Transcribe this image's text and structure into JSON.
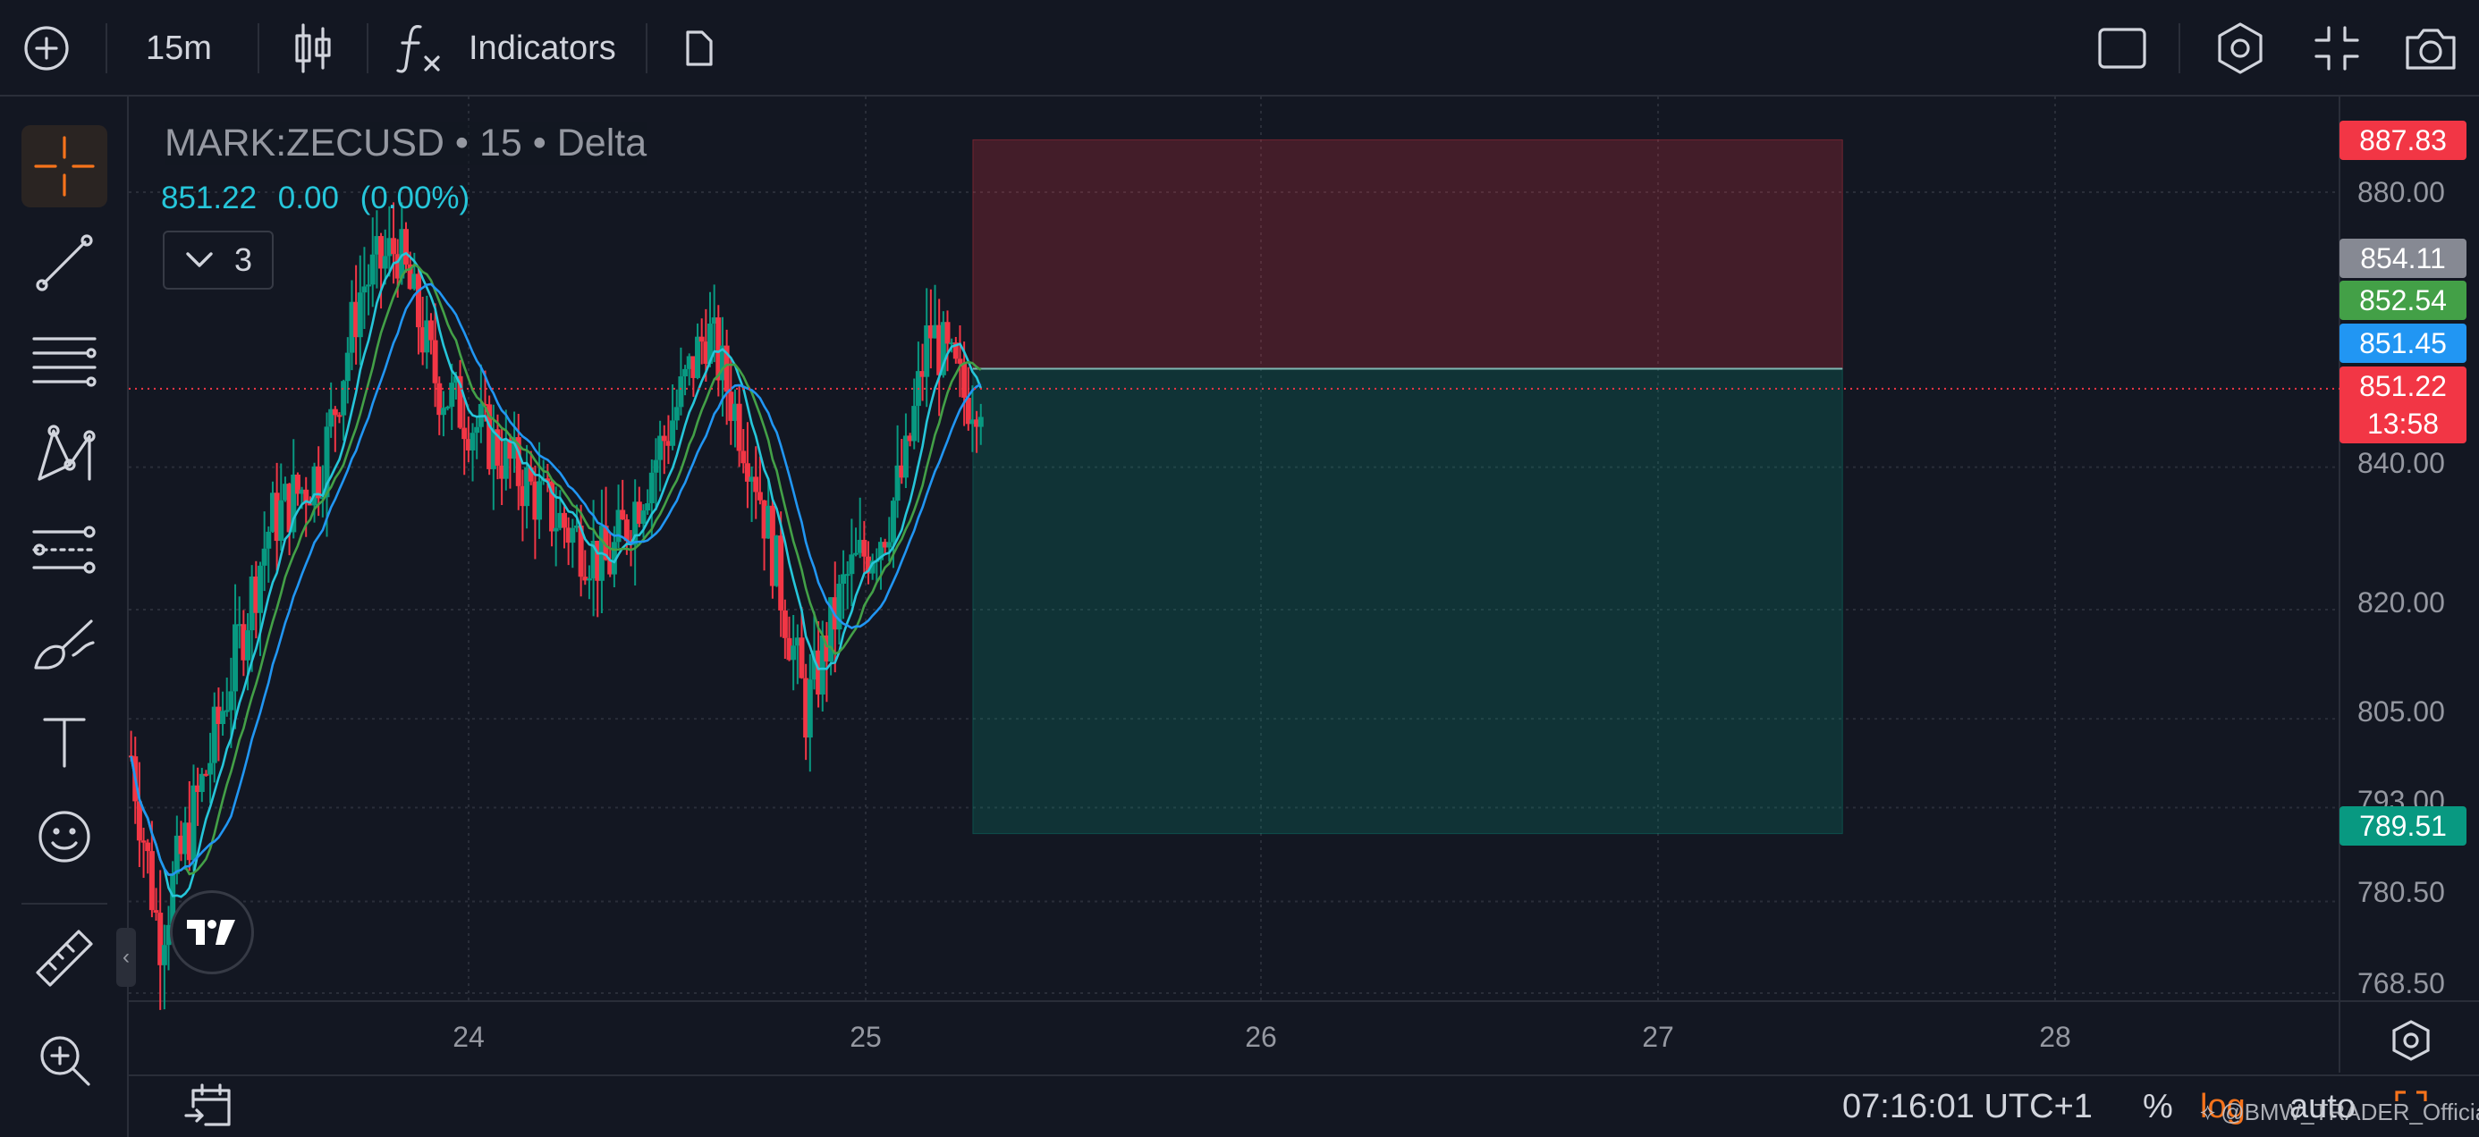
{
  "toolbar": {
    "interval": "15m",
    "indicators_label": "Indicators"
  },
  "legend": {
    "symbol": "MARK:ZECUSD",
    "interval": "15",
    "source": "Delta",
    "separator": "•",
    "price": "851.22",
    "change": "0.00",
    "change_pct": "(0.00%)",
    "indicator_count": "3"
  },
  "price_axis": {
    "ticks": [
      "880.00",
      "840.00",
      "820.00",
      "805.00",
      "793.00",
      "780.50",
      "768.50"
    ],
    "labels": [
      {
        "text": "887.83",
        "color": "#f23645"
      },
      {
        "text": "854.11",
        "color": "#868993"
      },
      {
        "text": "852.54",
        "color": "#43a047"
      },
      {
        "text": "851.45",
        "color": "#2196f3"
      },
      {
        "text": "851.22",
        "color": "#f23645"
      },
      {
        "text": "789.51",
        "color": "#089981"
      }
    ],
    "countdown": "13:58"
  },
  "time_axis": {
    "ticks": [
      "24",
      "25",
      "26",
      "27",
      "28"
    ]
  },
  "bottom": {
    "clock": "07:16:01 UTC+1",
    "percent": "%",
    "log": "log",
    "auto": "auto",
    "watermark": "@BMW_TRADER_Official"
  },
  "chart_data": {
    "type": "candlestick",
    "x": [
      "24",
      "25",
      "26",
      "27",
      "28"
    ],
    "y_ticks": [
      880.0,
      840.0,
      820.0,
      805.0,
      793.0,
      780.5,
      768.5
    ],
    "y_scale": "log",
    "last_price": 851.22,
    "moving_averages": [
      851.45,
      852.54,
      854.11
    ],
    "position_tool": {
      "entry": 854.11,
      "stop": 887.83,
      "target": 789.51,
      "stop_color": "#f23645",
      "target_color": "#089981"
    },
    "colors": {
      "up": "#089981",
      "down": "#f23645",
      "ma1": "#2196f3",
      "ma2": "#43a047",
      "ma3": "#26c6da"
    }
  }
}
